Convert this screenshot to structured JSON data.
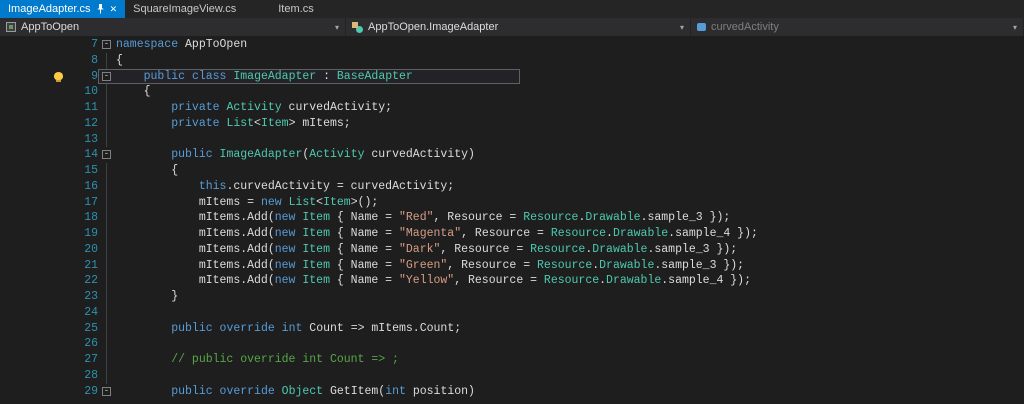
{
  "colors": {
    "accent": "#007ACC",
    "editorBg": "#1E1E1E",
    "chromeBg": "#2D2D30",
    "tabstripBg": "#252526",
    "keyword": "#569CD6",
    "type": "#4EC9B0",
    "string": "#D69D85",
    "comment": "#57A64A",
    "text": "#DCDCDC",
    "lineNumber": "#2B91AF"
  },
  "tabs": {
    "close_glyph": "✕",
    "items": [
      {
        "label": "ImageAdapter.cs",
        "state": "active",
        "pinned": true
      },
      {
        "label": "SquareImageView.cs",
        "state": "inactive"
      },
      {
        "label": "Item.cs",
        "state": "inactive"
      }
    ]
  },
  "navbar": {
    "chevron": "▾",
    "project": {
      "label": "AppToOpen"
    },
    "type": {
      "label": "AppToOpen.ImageAdapter"
    },
    "member": {
      "label": "curvedActivity"
    }
  },
  "editor": {
    "language": "csharp",
    "lines": [
      {
        "num": 7,
        "fold": true,
        "segs": [
          [
            "k",
            "namespace"
          ],
          [
            "p",
            " AppToOpen"
          ]
        ]
      },
      {
        "num": 8,
        "vl": true,
        "segs": [
          [
            "p",
            "{"
          ]
        ]
      },
      {
        "num": 9,
        "fold": true,
        "hl": true,
        "bulb": true,
        "segs": [
          [
            "p",
            "    "
          ],
          [
            "k",
            "public"
          ],
          [
            "p",
            " "
          ],
          [
            "k",
            "class"
          ],
          [
            "p",
            " "
          ],
          [
            "t",
            "ImageAdapter"
          ],
          [
            "p",
            " : "
          ],
          [
            "t",
            "BaseAdapter"
          ]
        ]
      },
      {
        "num": 10,
        "vl": true,
        "segs": [
          [
            "p",
            "    {"
          ]
        ]
      },
      {
        "num": 11,
        "vl": true,
        "segs": [
          [
            "p",
            "        "
          ],
          [
            "k",
            "private"
          ],
          [
            "p",
            " "
          ],
          [
            "t",
            "Activity"
          ],
          [
            "p",
            " curvedActivity;"
          ]
        ]
      },
      {
        "num": 12,
        "vl": true,
        "segs": [
          [
            "p",
            "        "
          ],
          [
            "k",
            "private"
          ],
          [
            "p",
            " "
          ],
          [
            "t",
            "List"
          ],
          [
            "p",
            "<"
          ],
          [
            "t",
            "Item"
          ],
          [
            "p",
            "> mItems;"
          ]
        ]
      },
      {
        "num": 13,
        "vl": true,
        "segs": []
      },
      {
        "num": 14,
        "fold": true,
        "segs": [
          [
            "p",
            "        "
          ],
          [
            "k",
            "public"
          ],
          [
            "p",
            " "
          ],
          [
            "t",
            "ImageAdapter"
          ],
          [
            "p",
            "("
          ],
          [
            "t",
            "Activity"
          ],
          [
            "p",
            " curvedActivity)"
          ]
        ]
      },
      {
        "num": 15,
        "vl": true,
        "segs": [
          [
            "p",
            "        {"
          ]
        ]
      },
      {
        "num": 16,
        "vl": true,
        "segs": [
          [
            "p",
            "            "
          ],
          [
            "k",
            "this"
          ],
          [
            "p",
            ".curvedActivity = curvedActivity;"
          ]
        ]
      },
      {
        "num": 17,
        "vl": true,
        "segs": [
          [
            "p",
            "            mItems = "
          ],
          [
            "k",
            "new"
          ],
          [
            "p",
            " "
          ],
          [
            "t",
            "List"
          ],
          [
            "p",
            "<"
          ],
          [
            "t",
            "Item"
          ],
          [
            "p",
            ">();"
          ]
        ]
      },
      {
        "num": 18,
        "vl": true,
        "segs": [
          [
            "p",
            "            mItems.Add("
          ],
          [
            "k",
            "new"
          ],
          [
            "p",
            " "
          ],
          [
            "t",
            "Item"
          ],
          [
            "p",
            " { Name = "
          ],
          [
            "s",
            "\"Red\""
          ],
          [
            "p",
            ", Resource = "
          ],
          [
            "t",
            "Resource"
          ],
          [
            "p",
            "."
          ],
          [
            "t",
            "Drawable"
          ],
          [
            "p",
            ".sample_3 });"
          ]
        ]
      },
      {
        "num": 19,
        "vl": true,
        "segs": [
          [
            "p",
            "            mItems.Add("
          ],
          [
            "k",
            "new"
          ],
          [
            "p",
            " "
          ],
          [
            "t",
            "Item"
          ],
          [
            "p",
            " { Name = "
          ],
          [
            "s",
            "\"Magenta\""
          ],
          [
            "p",
            ", Resource = "
          ],
          [
            "t",
            "Resource"
          ],
          [
            "p",
            "."
          ],
          [
            "t",
            "Drawable"
          ],
          [
            "p",
            ".sample_4 });"
          ]
        ]
      },
      {
        "num": 20,
        "vl": true,
        "segs": [
          [
            "p",
            "            mItems.Add("
          ],
          [
            "k",
            "new"
          ],
          [
            "p",
            " "
          ],
          [
            "t",
            "Item"
          ],
          [
            "p",
            " { Name = "
          ],
          [
            "s",
            "\"Dark\""
          ],
          [
            "p",
            ", Resource = "
          ],
          [
            "t",
            "Resource"
          ],
          [
            "p",
            "."
          ],
          [
            "t",
            "Drawable"
          ],
          [
            "p",
            ".sample_3 });"
          ]
        ]
      },
      {
        "num": 21,
        "vl": true,
        "segs": [
          [
            "p",
            "            mItems.Add("
          ],
          [
            "k",
            "new"
          ],
          [
            "p",
            " "
          ],
          [
            "t",
            "Item"
          ],
          [
            "p",
            " { Name = "
          ],
          [
            "s",
            "\"Green\""
          ],
          [
            "p",
            ", Resource = "
          ],
          [
            "t",
            "Resource"
          ],
          [
            "p",
            "."
          ],
          [
            "t",
            "Drawable"
          ],
          [
            "p",
            ".sample_3 });"
          ]
        ]
      },
      {
        "num": 22,
        "vl": true,
        "segs": [
          [
            "p",
            "            mItems.Add("
          ],
          [
            "k",
            "new"
          ],
          [
            "p",
            " "
          ],
          [
            "t",
            "Item"
          ],
          [
            "p",
            " { Name = "
          ],
          [
            "s",
            "\"Yellow\""
          ],
          [
            "p",
            ", Resource = "
          ],
          [
            "t",
            "Resource"
          ],
          [
            "p",
            "."
          ],
          [
            "t",
            "Drawable"
          ],
          [
            "p",
            ".sample_4 });"
          ]
        ]
      },
      {
        "num": 23,
        "vl": true,
        "segs": [
          [
            "p",
            "        }"
          ]
        ]
      },
      {
        "num": 24,
        "vl": true,
        "segs": []
      },
      {
        "num": 25,
        "vl": true,
        "segs": [
          [
            "p",
            "        "
          ],
          [
            "k",
            "public"
          ],
          [
            "p",
            " "
          ],
          [
            "k",
            "override"
          ],
          [
            "p",
            " "
          ],
          [
            "k",
            "int"
          ],
          [
            "p",
            " Count => mItems.Count;"
          ]
        ]
      },
      {
        "num": 26,
        "vl": true,
        "segs": []
      },
      {
        "num": 27,
        "vl": true,
        "segs": [
          [
            "p",
            "        "
          ],
          [
            "c",
            "// public override int Count => ;"
          ]
        ]
      },
      {
        "num": 28,
        "vl": true,
        "segs": []
      },
      {
        "num": 29,
        "fold": true,
        "segs": [
          [
            "p",
            "        "
          ],
          [
            "k",
            "public"
          ],
          [
            "p",
            " "
          ],
          [
            "k",
            "override"
          ],
          [
            "p",
            " "
          ],
          [
            "t",
            "Object"
          ],
          [
            "p",
            " GetItem("
          ],
          [
            "k",
            "int"
          ],
          [
            "p",
            " position)"
          ]
        ]
      }
    ]
  }
}
